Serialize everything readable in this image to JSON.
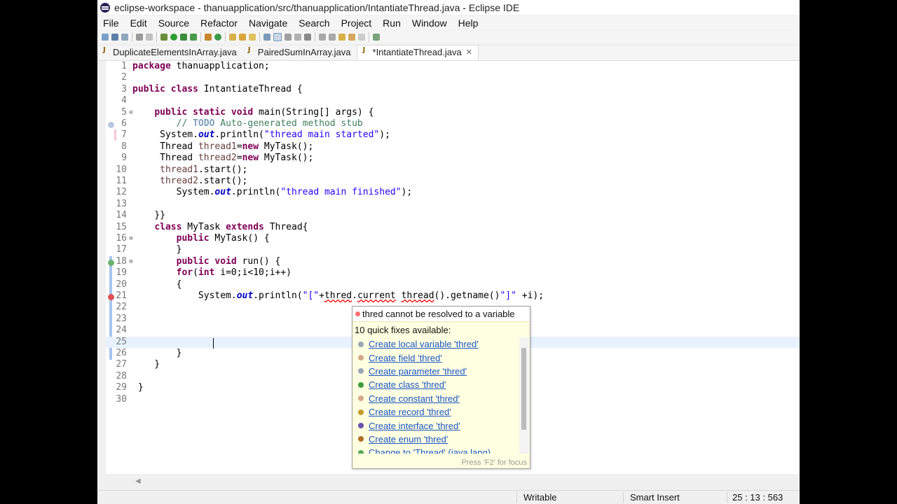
{
  "window": {
    "title": "eclipse-workspace - thanuapplication/src/thanuapplication/IntantiateThread.java - Eclipse IDE"
  },
  "menu": [
    "File",
    "Edit",
    "Source",
    "Refactor",
    "Navigate",
    "Search",
    "Project",
    "Run",
    "Window",
    "Help"
  ],
  "tabs": [
    {
      "label": "DuplicateElementsInArray.java",
      "active": false
    },
    {
      "label": "PairedSumInArray.java",
      "active": false
    },
    {
      "label": "*IntantiateThread.java",
      "active": true,
      "close": "✕"
    }
  ],
  "editor": {
    "line_numbers": [
      "1",
      "2",
      "3",
      "4",
      "5",
      "6",
      "7",
      "8",
      "9",
      "10",
      "11",
      "12",
      "13",
      "14",
      "15",
      "16",
      "17",
      "18",
      "19",
      "20",
      "21",
      "22",
      "23",
      "24",
      "25",
      "26",
      "27",
      "28",
      "29",
      "30"
    ],
    "current_line": 25,
    "code": {
      "l1_kw": "package",
      "l1_rest": " thanuapplication;",
      "l3_kw1": "public",
      "l3_kw2": "class",
      "l3_rest": " IntantiateThread {",
      "l5_indent": "    ",
      "l5_kw1": "public",
      "l5_kw2": "static",
      "l5_kw3": "void",
      "l5_rest": " main(String[] args) {",
      "l6_indent": "        ",
      "l6_cmt1": "// ",
      "l6_todo": "TODO",
      "l6_cmt2": " Auto-generated method stub",
      "l7_indent": "     ",
      "l7_a": "System.",
      "l7_out": "out",
      "l7_b": ".println(",
      "l7_str": "\"thread main started\"",
      "l7_c": ");",
      "l8_indent": "     ",
      "l8_a": "Thread ",
      "l8_var": "thread1",
      "l8_b": "=",
      "l8_kw": "new",
      "l8_c": " MyTask();",
      "l9_indent": "     ",
      "l9_a": "Thread ",
      "l9_var": "thread2",
      "l9_b": "=",
      "l9_kw": "new",
      "l9_c": " MyTask();",
      "l10_indent": "     ",
      "l10_var": "thread1",
      "l10_rest": ".start();",
      "l11_indent": "     ",
      "l11_var": "thread2",
      "l11_rest": ".start();",
      "l12_indent": "        ",
      "l12_a": "System.",
      "l12_out": "out",
      "l12_b": ".println(",
      "l12_str": "\"thread main finished\"",
      "l12_c": ");",
      "l14": "    }}",
      "l15_indent": "    ",
      "l15_kw1": "class",
      "l15_a": " MyTask ",
      "l15_kw2": "extends",
      "l15_b": " Thread{",
      "l16_indent": "        ",
      "l16_kw": "public",
      "l16_rest": " MyTask() {",
      "l17": "        }",
      "l18_indent": "        ",
      "l18_kw1": "public",
      "l18_kw2": "void",
      "l18_rest": " run() {",
      "l19_indent": "        ",
      "l19_kw1": "for",
      "l19_a": "(",
      "l19_kw2": "int",
      "l19_b": " i=0;i<10;i++)",
      "l20": "        {",
      "l21_indent": "            ",
      "l21_a": "System.",
      "l21_out": "out",
      "l21_b": ".println(",
      "l21_str": "\"[\"",
      "l21_c": "+",
      "l21_err1": "thred",
      "l21_d": ".",
      "l21_err2": "current",
      "l21_e": " ",
      "l21_err3": "thread",
      "l21_f": "().getname()",
      "l21_str2": "\"]\"",
      "l21_g": " +i);",
      "l26": "        }",
      "l27": "    }",
      "l29": " }"
    }
  },
  "quickfix": {
    "error": "thred cannot be resolved to a variable",
    "count_label": "10 quick fixes available:",
    "fixes": [
      {
        "label": "Create local variable 'thred'",
        "icon_color": "#9aa7b8"
      },
      {
        "label": "Create field 'thred'",
        "icon_color": "#d6a88c"
      },
      {
        "label": "Create parameter 'thred'",
        "icon_color": "#9aa7b8"
      },
      {
        "label": "Create class 'thred'",
        "icon_color": "#3b9b3b"
      },
      {
        "label": "Create constant 'thred'",
        "icon_color": "#d6a88c"
      },
      {
        "label": "Create record 'thred'",
        "icon_color": "#c49a2a"
      },
      {
        "label": "Create interface 'thred'",
        "icon_color": "#6a4fb3"
      },
      {
        "label": "Create enum 'thred'",
        "icon_color": "#b2702a"
      },
      {
        "label": "Change to 'Thread' (java.lang)",
        "icon_color": "#58a858"
      }
    ],
    "focus_hint": "Press 'F2' for focus"
  },
  "status": {
    "writable": "Writable",
    "insert_mode": "Smart Insert",
    "position": "25 : 13 : 563"
  }
}
